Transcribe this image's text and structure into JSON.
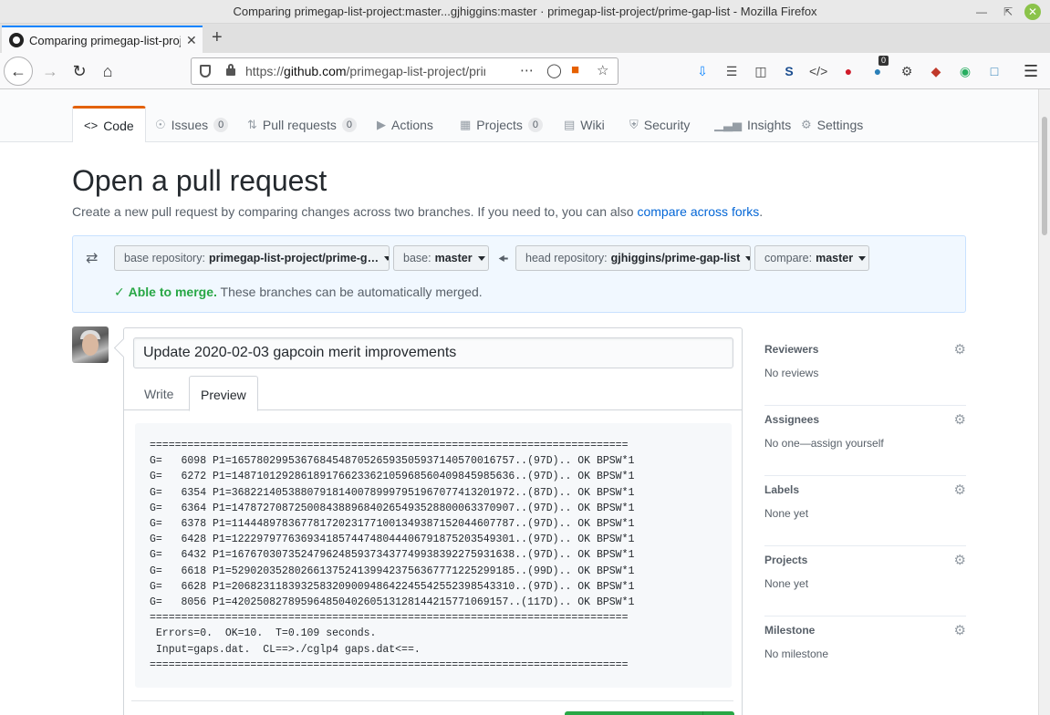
{
  "browser": {
    "window_title": "Comparing primegap-list-project:master...gjhiggins:master · primegap-list-project/prime-gap-list - Mozilla Firefox",
    "tab_title": "Comparing primegap-list-project:master...gjhiggins:master · primegap-list-project/prime-gap-list",
    "url_prefix": "https://",
    "url_domain": "github.com",
    "url_path": "/primegap-list-project/prime-gap-list/compare/master...gjhiggins:master",
    "extension_badge": "0"
  },
  "repo_nav": {
    "tabs": [
      {
        "label": "Code",
        "icon": "code-icon"
      },
      {
        "label": "Issues",
        "count": "0",
        "icon": "issue-icon"
      },
      {
        "label": "Pull requests",
        "count": "0",
        "icon": "pull-request-icon"
      },
      {
        "label": "Actions",
        "icon": "play-icon"
      },
      {
        "label": "Projects",
        "count": "0",
        "icon": "project-icon"
      },
      {
        "label": "Wiki",
        "icon": "book-icon"
      },
      {
        "label": "Security",
        "icon": "shield-icon"
      },
      {
        "label": "Insights",
        "icon": "graph-icon"
      },
      {
        "label": "Settings",
        "icon": "gear-icon"
      }
    ]
  },
  "page": {
    "title": "Open a pull request",
    "subtitle": "Create a new pull request by comparing changes across two branches. If you need to, you can also",
    "subtitle_link": "compare across forks",
    "subtitle_end": "."
  },
  "range": {
    "base_repo_label": "base repository:",
    "base_repo_value": "primegap-list-project/prime-g…",
    "base_label": "base:",
    "base_value": "master",
    "head_repo_label": "head repository:",
    "head_repo_value": "gjhiggins/prime-gap-list",
    "compare_label": "compare:",
    "compare_value": "master",
    "merge_status": "Able to merge.",
    "merge_message": "These branches can be automatically merged."
  },
  "form": {
    "title_value": "Update 2020-02-03 gapcoin merit improvements",
    "write_tab": "Write",
    "preview_tab": "Preview",
    "preview_lines": [
      "============================================================================",
      "G=   6098 P1=1657802995367684548705265935059371405700167 57..(97D).. OK BPSW*1",
      "G=   6272 P1=1487101292861891766233621059685604098459856 36..(97D).. OK BPSW*1",
      "G=   6354 P1=3682214053880791814007899979519670774132019 72..(87D).. OK BPSW*1",
      "G=   6364 P1=1478727087250084388968402654935288000633709 07..(97D).. OK BPSW*1",
      "G=   6378 P1=1144489783677817202317710013493871520446077 87..(97D).. OK BPSW*1",
      "G=   6428 P1=1222979776369341857447480444067918752035493 01..(97D).. OK BPSW*1",
      "G=   6432 P1=1676703073524796248593734377499383922759316 38..(97D).. OK BPSW*1",
      "G=   6618 P1=5290203528026613752413994237563677712252991 85..(99D).. OK BPSW*1",
      "G=   6628 P1=2068231183932583209009486422455425523985433 10..(97D).. OK BPSW*1",
      "G=   8056 P1=4202508278959648504026051312814421577106915 7..(117D).. OK BPSW*1",
      "============================================================================",
      " Errors=0.  OK=10.  T=0.109 seconds.",
      " Input=gaps.dat.  CL==>./cglp4 gaps.dat<==.",
      "============================================================================"
    ]
  },
  "sidebar": {
    "sections": [
      {
        "heading": "Reviewers",
        "value": "No reviews"
      },
      {
        "heading": "Assignees",
        "value": "No one—assign yourself"
      },
      {
        "heading": "Labels",
        "value": "None yet"
      },
      {
        "heading": "Projects",
        "value": "None yet"
      },
      {
        "heading": "Milestone",
        "value": "No milestone"
      }
    ]
  }
}
